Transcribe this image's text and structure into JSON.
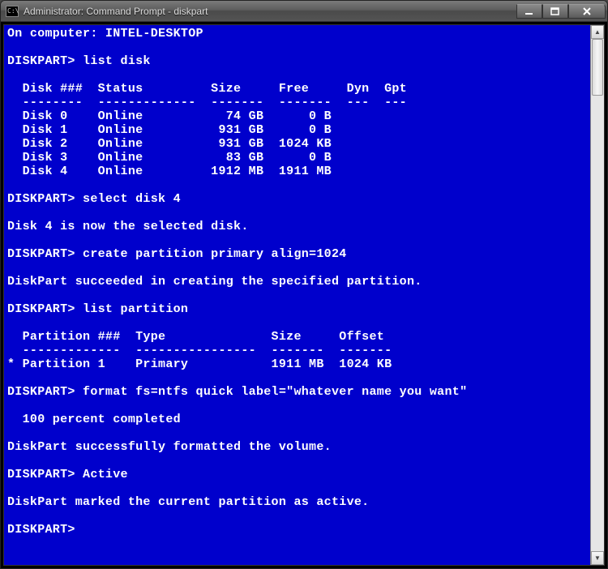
{
  "window": {
    "title": "Administrator: Command Prompt - diskpart"
  },
  "terminal": {
    "lines": [
      "On computer: INTEL-DESKTOP",
      "",
      "DISKPART> list disk",
      "",
      "  Disk ###  Status         Size     Free     Dyn  Gpt",
      "  --------  -------------  -------  -------  ---  ---",
      "  Disk 0    Online           74 GB      0 B",
      "  Disk 1    Online          931 GB      0 B",
      "  Disk 2    Online          931 GB  1024 KB",
      "  Disk 3    Online           83 GB      0 B",
      "  Disk 4    Online         1912 MB  1911 MB",
      "",
      "DISKPART> select disk 4",
      "",
      "Disk 4 is now the selected disk.",
      "",
      "DISKPART> create partition primary align=1024",
      "",
      "DiskPart succeeded in creating the specified partition.",
      "",
      "DISKPART> list partition",
      "",
      "  Partition ###  Type              Size     Offset",
      "  -------------  ----------------  -------  -------",
      "* Partition 1    Primary           1911 MB  1024 KB",
      "",
      "DISKPART> format fs=ntfs quick label=\"whatever name you want\"",
      "",
      "  100 percent completed",
      "",
      "DiskPart successfully formatted the volume.",
      "",
      "DISKPART> Active",
      "",
      "DiskPart marked the current partition as active.",
      "",
      "DISKPART>"
    ]
  }
}
